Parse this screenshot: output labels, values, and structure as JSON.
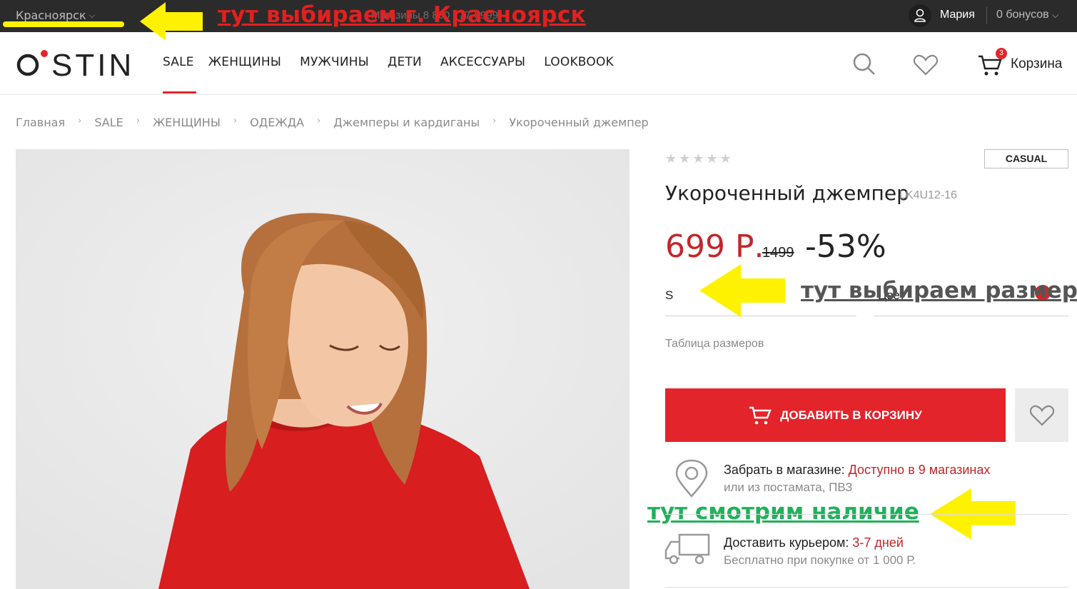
{
  "topbar": {
    "city": "Красноярск",
    "store_phone": "Магазины  8 800 777-0999",
    "user_name": "Мария",
    "bonuses": "0 бонусов"
  },
  "header": {
    "logo": "O'STIN",
    "nav": [
      "SALE",
      "ЖЕНЩИНЫ",
      "МУЖЧИНЫ",
      "ДЕТИ",
      "АКСЕССУАРЫ",
      "LOOKBOOK"
    ],
    "cart_count": "3",
    "cart_label": "Корзина"
  },
  "breadcrumbs": [
    "Главная",
    "SALE",
    "ЖЕНЩИНЫ",
    "ОДЕЖДА",
    "Джемперы и кардиганы",
    "Укороченный джемпер"
  ],
  "product": {
    "badge": "CASUAL",
    "title": "Укороченный джемпер",
    "sku": "LK4U12-16",
    "price": "699 Р.",
    "old_price": "1499",
    "discount": "-53%",
    "size": "S",
    "color_partial": "Цвет",
    "size_table": "Таблица размеров",
    "add_to_cart": "ДОБАВИТЬ В КОРЗИНУ",
    "rating": 0
  },
  "delivery": {
    "pickup_label": "Забрать в магазине: ",
    "pickup_avail": "Доступно в 9 магазинах",
    "pickup_sub": "или из постамата, ПВЗ",
    "courier_label": "Доставить курьером: ",
    "courier_days": "3-7 дней",
    "courier_sub": "Бесплатно при покупке от 1 000 Р."
  },
  "annotations": {
    "city": "тут выбираем г. Красноярск",
    "size": "тут выбираем размер",
    "stock": "тут смотрим наличие"
  },
  "colors": {
    "accent": "#e3242b",
    "price": "#c3262b",
    "annotation_yellow": "#fff200",
    "annotation_green": "#1fb25a"
  }
}
